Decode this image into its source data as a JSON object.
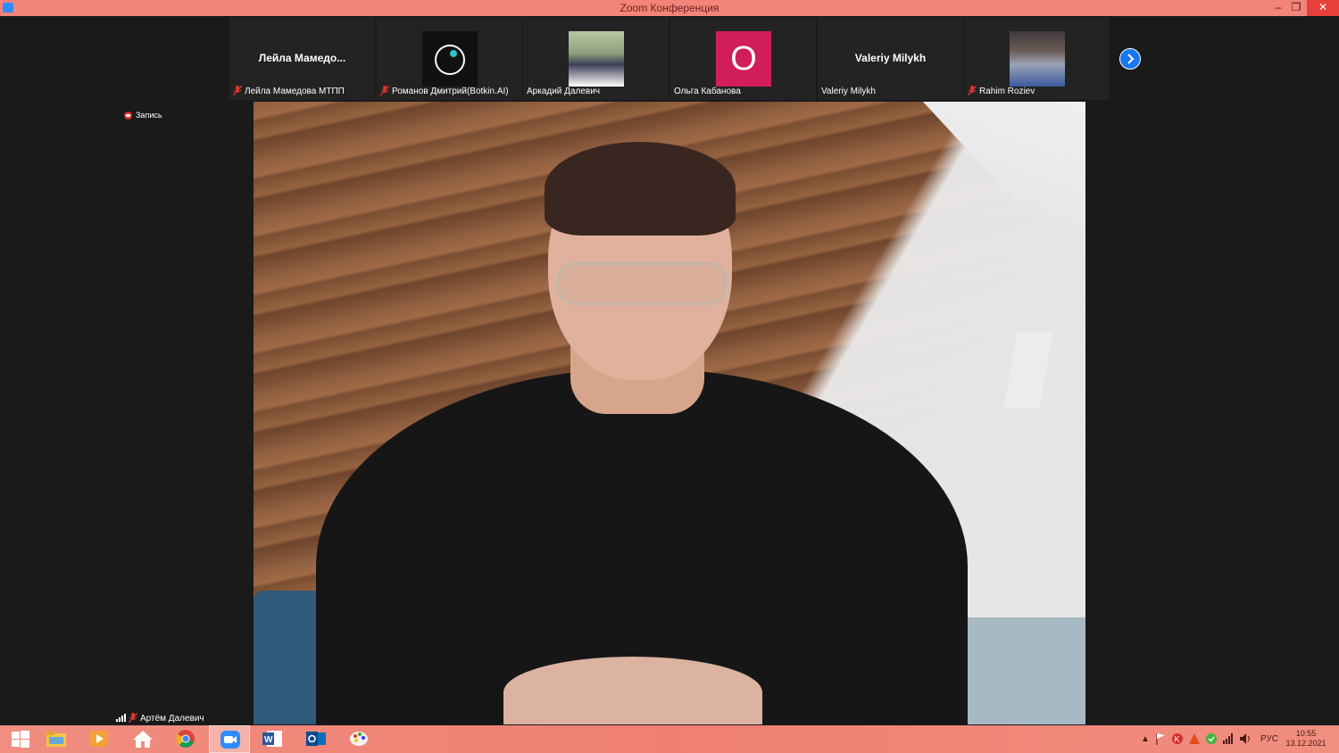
{
  "window": {
    "title": "Zoom Конференция",
    "minimize": "–",
    "restore": "❐",
    "close": "✕",
    "accent": "#f2847a"
  },
  "gallery": {
    "tiles": [
      {
        "big_name": "Лейла  Мамедо...",
        "caption": "Лейла Мамедова МТПП",
        "muted": true
      },
      {
        "caption": "Романов Дмитрий(Botkin.AI)",
        "muted": true,
        "thumb": "logo"
      },
      {
        "caption": "Аркадий Далевич",
        "muted": false,
        "thumb": "photo"
      },
      {
        "initial": "О",
        "caption": "Ольга Кабанова",
        "muted": false,
        "initial_color": "#d11d5a"
      },
      {
        "big_name": "Valeriy Milykh",
        "caption": "Valeriy Milykh",
        "muted": false
      },
      {
        "caption": "Rahim Roziev",
        "muted": true,
        "thumb": "photo"
      }
    ],
    "next_icon": "chevron-right-icon"
  },
  "recording": {
    "label": "Запись"
  },
  "self": {
    "name": "Артём Далевич",
    "muted": true
  },
  "taskbar": {
    "apps": [
      "windows-start-icon",
      "file-explorer-icon",
      "media-player-icon",
      "home-icon",
      "chrome-icon",
      "zoom-icon",
      "word-icon",
      "outlook-icon",
      "paint-icon"
    ],
    "active_app": "zoom-icon",
    "tray": {
      "language": "РУС",
      "time": "10:55",
      "date": "13.12.2021"
    }
  }
}
